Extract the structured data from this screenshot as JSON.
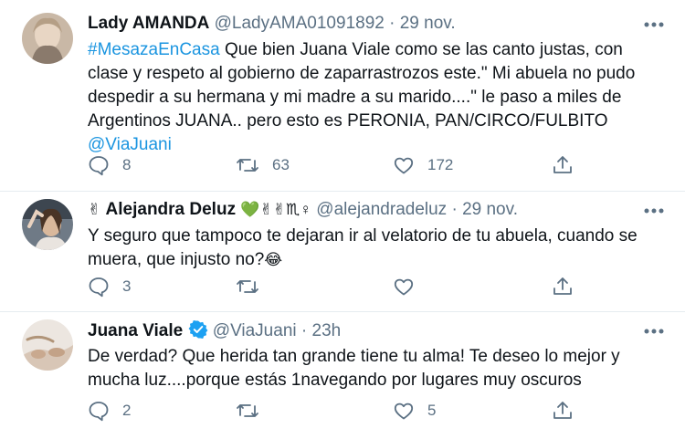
{
  "tweets": [
    {
      "author": "Lady AMANDA",
      "handle": "@LadyAMA01091892",
      "separator": "·",
      "time": "29 nov.",
      "hashtag": "#MesazaEnCasa",
      "text": " Que bien Juana Viale como se las canto justas, con clase y respeto al gobierno de zaparrastrozos este.\" Mi abuela no pudo despedir a su hermana y mi madre a su marido....\" le paso a miles de Argentinos JUANA.. pero esto es PERONIA, PAN/CIRCO/FULBITO",
      "mention": "@ViaJuani",
      "replies": "8",
      "retweets": "63",
      "likes": "172"
    },
    {
      "author": "Alejandra Deluz",
      "name_prefix_emoji": "✌",
      "name_suffix_emojis": "💚✌✌♏♀",
      "handle": "@alejandradeluz",
      "separator": "·",
      "time": "29 nov.",
      "text": "Y seguro que tampoco te dejaran ir al velatorio de tu abuela, cuando se muera, que injusto no?",
      "text_emoji": "😂",
      "replies": "3",
      "retweets": "",
      "likes": ""
    },
    {
      "author": "Juana Viale",
      "verified": true,
      "handle": "@ViaJuani",
      "separator": "·",
      "time": "23h",
      "text": "De verdad? Que herida tan grande tiene tu alma! Te deseo lo mejor y mucha luz....porque estás 1navegando por lugares muy oscuros",
      "replies": "2",
      "retweets": "",
      "likes": "5"
    }
  ],
  "colors": {
    "text": "#0f1419",
    "secondary": "#5b7083",
    "link": "#1b95e0",
    "verified": "#1da1f2",
    "divider": "#e6ecf0"
  }
}
